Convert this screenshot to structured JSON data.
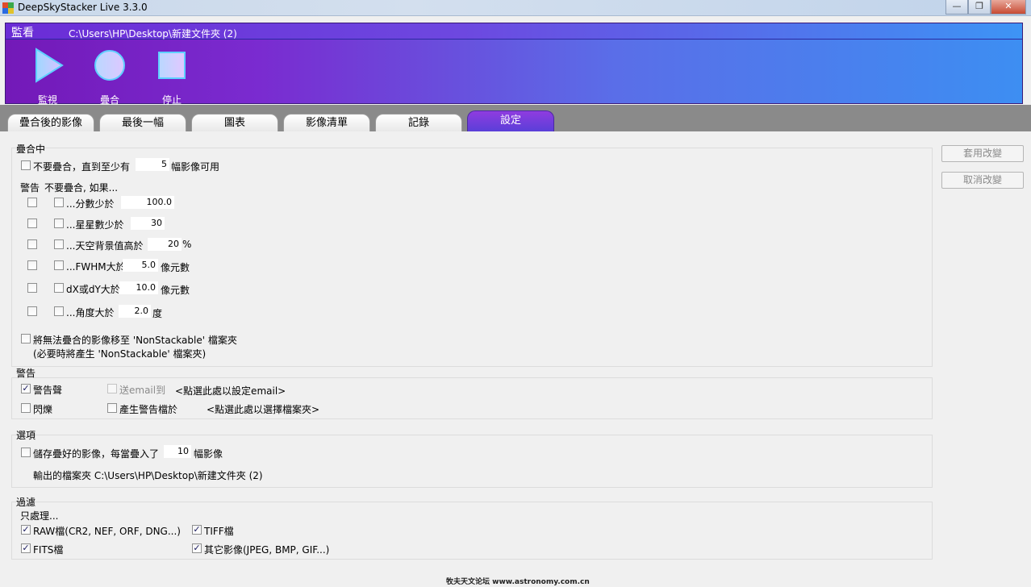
{
  "window": {
    "title": "DeepSkyStacker Live 3.3.0",
    "controls": [
      "—",
      "❐",
      "✕"
    ]
  },
  "header": {
    "label": "監看",
    "path": "C:\\Users\\HP\\Desktop\\新建文件夾 (2)",
    "buttons": [
      {
        "label": "監視",
        "icon": "play-icon"
      },
      {
        "label": "疊合",
        "icon": "circle-icon"
      },
      {
        "label": "停止",
        "icon": "stop-icon"
      }
    ]
  },
  "tabs": [
    "疊合後的影像",
    "最後一幅",
    "圖表",
    "影像清單",
    "記錄",
    "設定"
  ],
  "active_tab": "設定",
  "stacking": {
    "title": "疊合中",
    "dont_stack_label": "不要疊合，直到至少有",
    "min_images": "5",
    "min_images_suffix": "幅影像可用",
    "warning_header": "警告",
    "dont_stack_if": "不要疊合, 如果...",
    "rows": [
      {
        "label": "...分數少於",
        "value": "100.0",
        "unit": ""
      },
      {
        "label": "...星星數少於",
        "value": "30",
        "unit": ""
      },
      {
        "label": "...天空背景值高於",
        "value": "20",
        "unit": "%"
      },
      {
        "label": "...FWHM大於",
        "value": "5.0",
        "unit": "像元數"
      },
      {
        "label": "dX或dY大於",
        "value": "10.0",
        "unit": "像元數"
      },
      {
        "label": "...角度大於",
        "value": "2.0",
        "unit": "度"
      }
    ],
    "move_nonstackable": "將無法疊合的影像移至 'NonStackable' 檔案夾",
    "move_nonstackable_note": "(必要時將產生 'NonStackable' 檔案夾)"
  },
  "warnings": {
    "title": "警告",
    "sound": "警告聲",
    "email": "送email到",
    "email_link": "<點選此處以設定email>",
    "flash": "閃爍",
    "warning_file": "產生警告檔於",
    "folder_link": "<點選此處以選擇檔案夾>"
  },
  "options": {
    "title": "選項",
    "save_label": "儲存疊好的影像，每當疊入了",
    "save_count": "10",
    "save_suffix": "幅影像",
    "output_folder": "輸出的檔案夾 C:\\Users\\HP\\Desktop\\新建文件夾 (2)"
  },
  "filters": {
    "title": "過濾",
    "only_process": "只處理...",
    "raw": "RAW檔(CR2, NEF, ORF, DNG...)",
    "tiff": "TIFF檔",
    "fits": "FITS檔",
    "other": "其它影像(JPEG, BMP, GIF...)"
  },
  "side_buttons": {
    "apply": "套用改變",
    "cancel": "取消改變"
  },
  "watermark": "牧夫天文论坛 www.astronomy.com.cn",
  "colors": {
    "header_purple": "#7319b8",
    "header_blue": "#3d8ef2",
    "tab_active": "#7a3ce0"
  }
}
